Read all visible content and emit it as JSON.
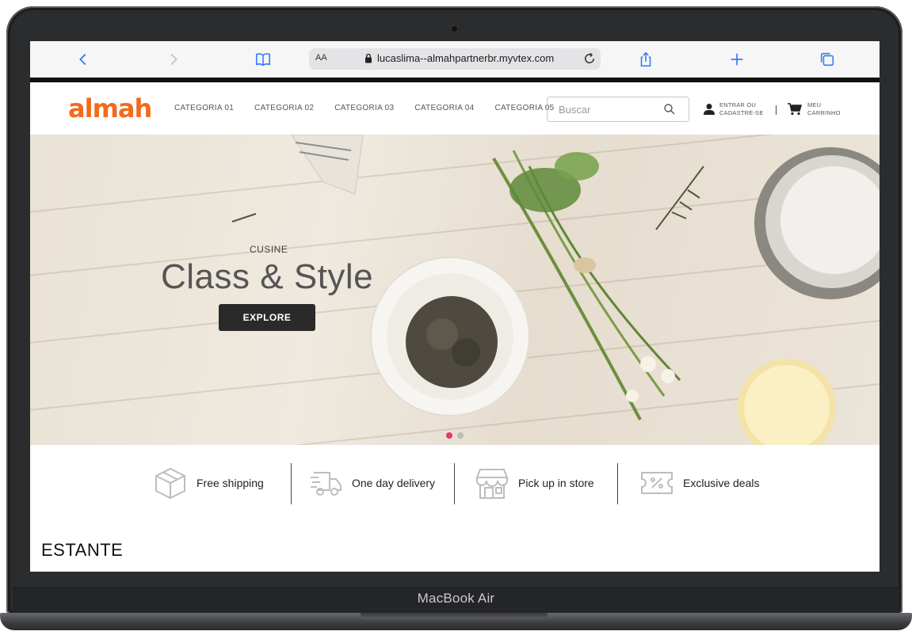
{
  "device": {
    "model_label": "MacBook Air"
  },
  "browser": {
    "text_size_label": "AA",
    "url": "lucaslima--almahpartnerbr.myvtex.com"
  },
  "site": {
    "logo": "almah",
    "nav": [
      "CATEGORIA 01",
      "CATEGORIA 02",
      "CATEGORIA 03",
      "CATEGORIA 04",
      "CATEGORIA 05"
    ],
    "search_placeholder": "Buscar",
    "account": {
      "line1": "ENTRAR OU",
      "line2": "CADASTRE-SE"
    },
    "cart": {
      "line1": "MEU",
      "line2": "CARRINHO"
    }
  },
  "hero": {
    "eyebrow": "CUSINE",
    "title": "Class & Style",
    "button": "EXPLORE",
    "slides": 2,
    "active_slide": 1
  },
  "features": [
    {
      "icon": "box-icon",
      "label": "Free shipping"
    },
    {
      "icon": "truck-icon",
      "label": "One day delivery"
    },
    {
      "icon": "store-icon",
      "label": "Pick up in store"
    },
    {
      "icon": "ticket-icon",
      "label": "Exclusive deals"
    }
  ],
  "section": {
    "title": "ESTANTE"
  },
  "colors": {
    "brand": "#f26a1b",
    "browser_accent": "#2f7cf6",
    "slide_active": "#e8356d"
  }
}
